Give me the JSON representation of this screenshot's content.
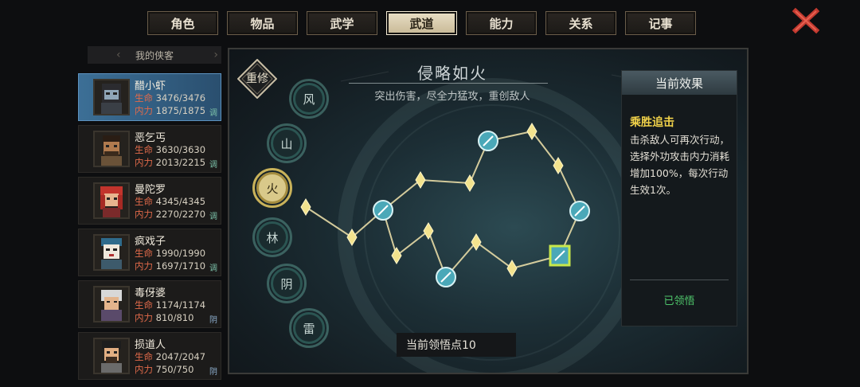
{
  "tabs": [
    "角色",
    "物品",
    "武学",
    "武道",
    "能力",
    "关系",
    "记事"
  ],
  "active_tab": 3,
  "roster": {
    "title": "我的侠客",
    "heroes": [
      {
        "name": "醋小虾",
        "hp": "生命",
        "hp_val": "3476/3476",
        "mp": "内力",
        "mp_val": "1875/1875",
        "tag": "调",
        "selected": true
      },
      {
        "name": "恶乞丐",
        "hp": "生命",
        "hp_val": "3630/3630",
        "mp": "内力",
        "mp_val": "2013/2215",
        "tag": "调"
      },
      {
        "name": "曼陀罗",
        "hp": "生命",
        "hp_val": "4345/4345",
        "mp": "内力",
        "mp_val": "2270/2270",
        "tag": "调"
      },
      {
        "name": "疯戏子",
        "hp": "生命",
        "hp_val": "1990/1990",
        "mp": "内力",
        "mp_val": "1697/1710",
        "tag": "调"
      },
      {
        "name": "毒伢婆",
        "hp": "生命",
        "hp_val": "1174/1174",
        "mp": "内力",
        "mp_val": "810/810",
        "tag": "阴"
      },
      {
        "name": "损道人",
        "hp": "生命",
        "hp_val": "2047/2047",
        "mp": "内力",
        "mp_val": "750/750",
        "tag": "阴"
      }
    ]
  },
  "main": {
    "title": "侵略如火",
    "subtitle": "突出伤害，尽全力猛攻，重创敌人",
    "reset_label": "重修",
    "stances": [
      "风",
      "山",
      "火",
      "林",
      "阴",
      "雷"
    ],
    "active_stance": 2,
    "points_label": "当前领悟点10"
  },
  "effect": {
    "header": "当前效果",
    "name": "乘胜追击",
    "description": "击杀敌人可再次行动，选择外功攻击内力消耗增加100%，每次行动生效1次。",
    "status": "已领悟"
  },
  "icons": {
    "close": "close-x-icon",
    "reset": "diamond-badge-icon"
  },
  "colors": {
    "active_tab": "#d9ccaa",
    "selected_hero": "#3c6f96",
    "effect_name": "#f2d34a",
    "status": "#4ec46a"
  }
}
